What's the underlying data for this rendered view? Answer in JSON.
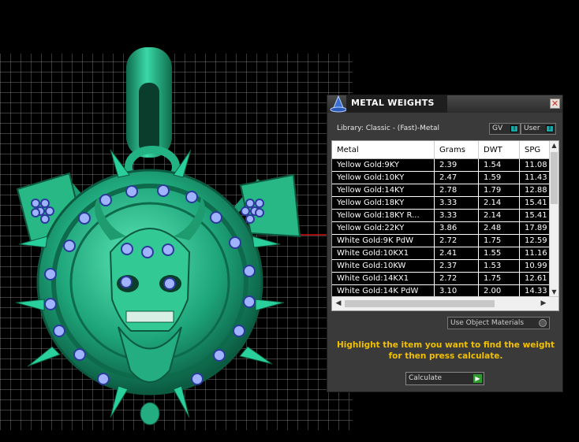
{
  "panel": {
    "title": "METAL WEIGHTS",
    "close_glyph": "✕",
    "library_label": "Library: Classic - (Fast)-Metal",
    "toggle_gv": "GV",
    "toggle_user": "User",
    "toggle_glyph": "I",
    "columns": [
      "Metal",
      "Grams",
      "DWT",
      "SPG"
    ],
    "rows": [
      [
        "Yellow Gold:9KY",
        "2.39",
        "1.54",
        "11.08"
      ],
      [
        "Yellow Gold:10KY",
        "2.47",
        "1.59",
        "11.43"
      ],
      [
        "Yellow Gold:14KY",
        "2.78",
        "1.79",
        "12.88"
      ],
      [
        "Yellow Gold:18KY",
        "3.33",
        "2.14",
        "15.41"
      ],
      [
        "Yellow Gold:18KY R...",
        "3.33",
        "2.14",
        "15.41"
      ],
      [
        "Yellow Gold:22KY",
        "3.86",
        "2.48",
        "17.89"
      ],
      [
        "White Gold:9K PdW",
        "2.72",
        "1.75",
        "12.59"
      ],
      [
        "White Gold:10KX1",
        "2.41",
        "1.55",
        "11.16"
      ],
      [
        "White Gold:10KW",
        "2.37",
        "1.53",
        "10.99"
      ],
      [
        "White Gold:14KX1",
        "2.72",
        "1.75",
        "12.61"
      ],
      [
        "White Gold:14K PdW",
        "3.10",
        "2.00",
        "14.33"
      ]
    ],
    "use_object_materials": "Use Object Materials",
    "hint": "Highlight the item you want to find the weight for then press calculate.",
    "calculate_label": "Calculate",
    "calculate_glyph": "▶"
  },
  "icons": {
    "app": "wizard-hat-icon",
    "scroll_up": "▲",
    "scroll_down": "▼",
    "scroll_left": "◀",
    "scroll_right": "▶"
  },
  "colors": {
    "model": "#2fc99a",
    "gems": "#8fa8ff",
    "hint": "#f0c000"
  }
}
